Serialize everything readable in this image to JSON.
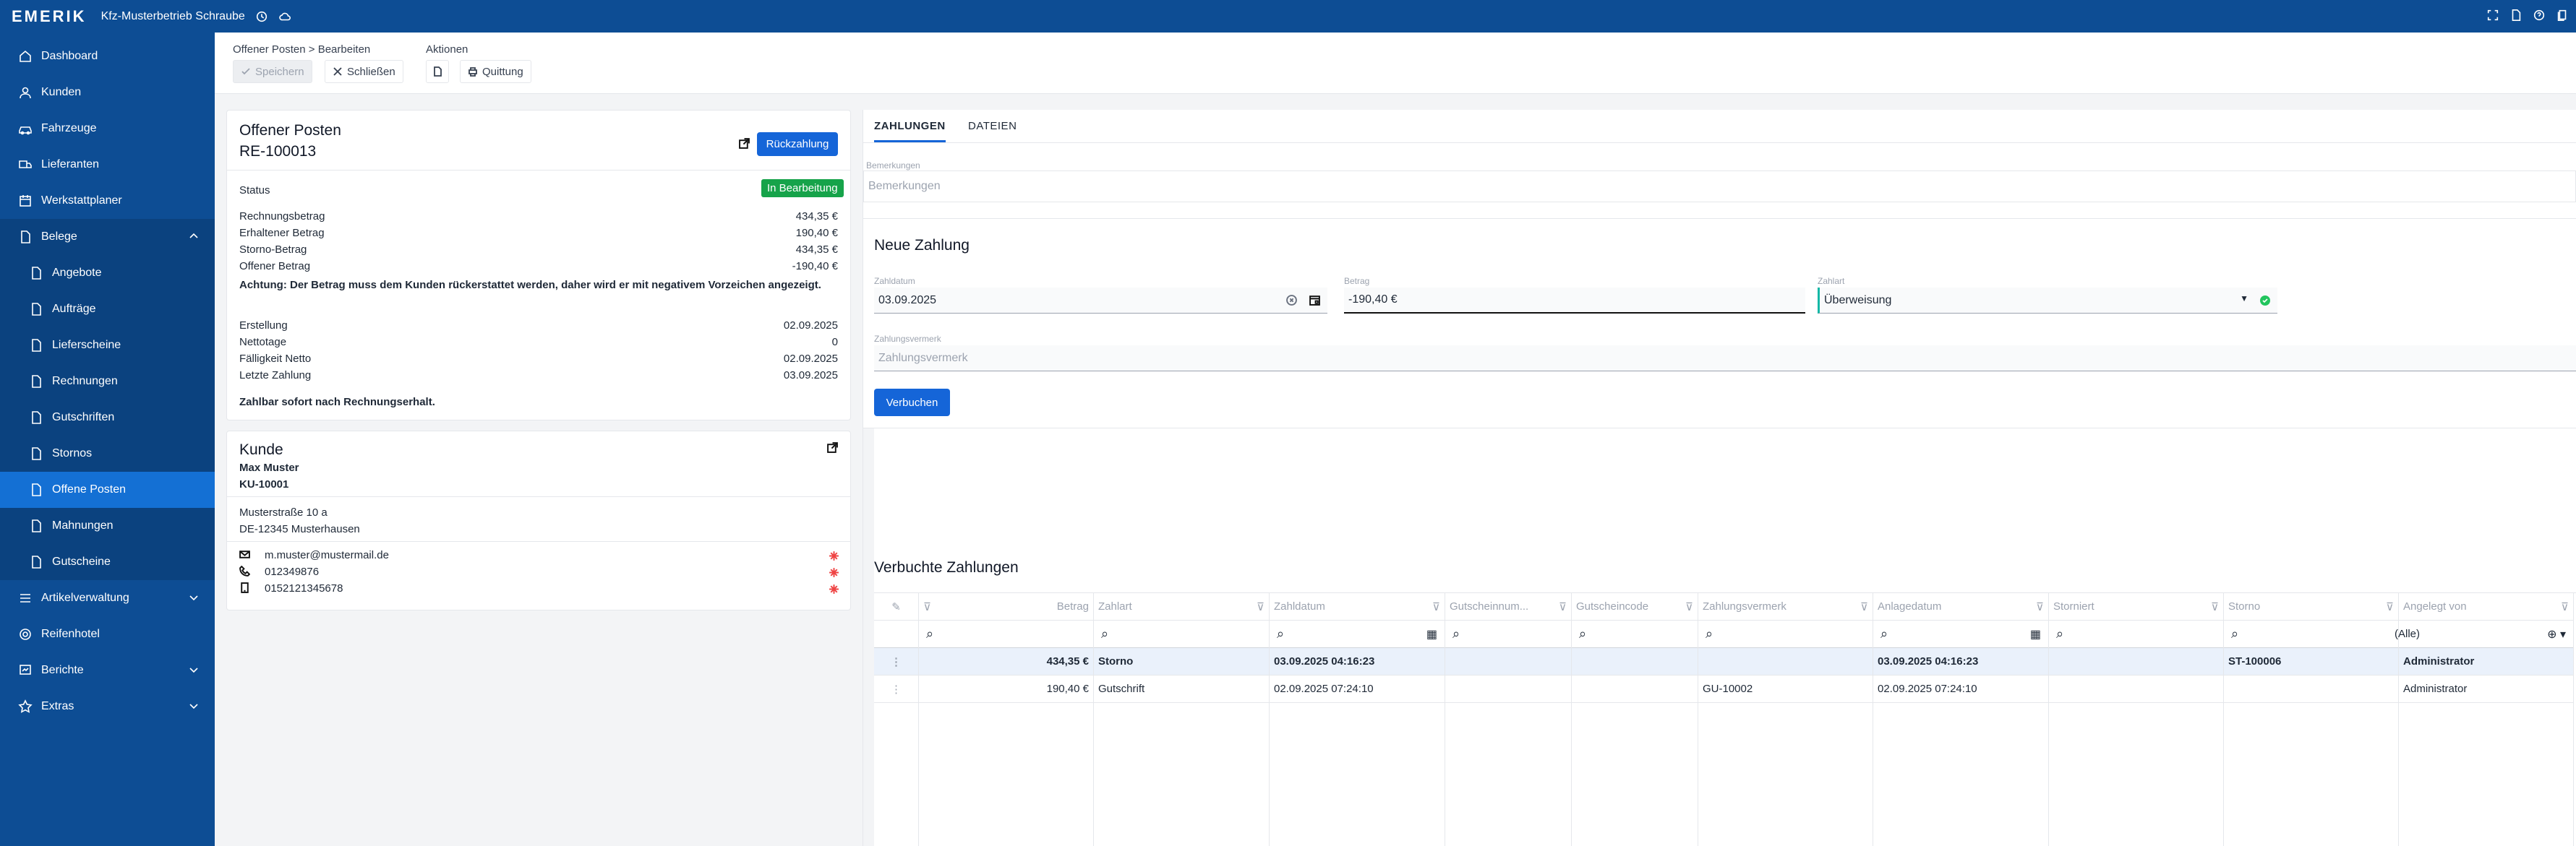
{
  "app": {
    "brand": "EMERIK",
    "tenant": "Kfz-Musterbetrieb Schraube"
  },
  "sidebar": {
    "items": [
      {
        "label": "Dashboard",
        "icon": "home-icon"
      },
      {
        "label": "Kunden",
        "icon": "user-icon"
      },
      {
        "label": "Fahrzeuge",
        "icon": "car-icon"
      },
      {
        "label": "Lieferanten",
        "icon": "truck-icon"
      },
      {
        "label": "Werkstattplaner",
        "icon": "calendar-icon"
      },
      {
        "label": "Belege",
        "icon": "document-icon"
      },
      {
        "label": "Angebote",
        "icon": "document-icon"
      },
      {
        "label": "Aufträge",
        "icon": "document-icon"
      },
      {
        "label": "Lieferscheine",
        "icon": "document-icon"
      },
      {
        "label": "Rechnungen",
        "icon": "document-icon"
      },
      {
        "label": "Gutschriften",
        "icon": "document-icon"
      },
      {
        "label": "Stornos",
        "icon": "document-icon"
      },
      {
        "label": "Offene Posten",
        "icon": "document-icon"
      },
      {
        "label": "Mahnungen",
        "icon": "document-icon"
      },
      {
        "label": "Gutscheine",
        "icon": "document-icon"
      },
      {
        "label": "Artikelverwaltung",
        "icon": "list-icon"
      },
      {
        "label": "Reifenhotel",
        "icon": "tire-icon"
      },
      {
        "label": "Berichte",
        "icon": "chart-icon"
      },
      {
        "label": "Extras",
        "icon": "star-icon"
      }
    ]
  },
  "breadcrumb": "Offener Posten > Bearbeiten",
  "actions_label": "Aktionen",
  "toolbar": {
    "save": "Speichern",
    "close": "Schließen",
    "receipt": "Quittung"
  },
  "op": {
    "title": "Offener Posten",
    "number": "RE-100013",
    "refund": "Rückzahlung",
    "status_label": "Status",
    "status": "In Bearbeitung",
    "rows": [
      [
        "Rechnungsbetrag",
        "434,35 €"
      ],
      [
        "Erhaltener Betrag",
        "190,40 €"
      ],
      [
        "Storno-Betrag",
        "434,35 €"
      ],
      [
        "Offener Betrag",
        "-190,40 €"
      ]
    ],
    "warning": "Achtung: Der Betrag muss dem Kunden rückerstattet werden, daher wird er mit negativem Vorzeichen angezeigt.",
    "dates": [
      [
        "Erstellung",
        "02.09.2025"
      ],
      [
        "Nettotage",
        "0"
      ],
      [
        "Fälligkeit Netto",
        "02.09.2025"
      ],
      [
        "Letzte Zahlung",
        "03.09.2025"
      ]
    ],
    "terms": "Zahlbar sofort nach Rechnungserhalt."
  },
  "customer": {
    "title": "Kunde",
    "name": "Max Muster",
    "number": "KU-10001",
    "street": "Musterstraße 10 a",
    "city": "DE-12345 Musterhausen",
    "email": "m.muster@mustermail.de",
    "phone": "012349876",
    "mobile": "0152121345678"
  },
  "tabs": [
    "ZAHLUNGEN",
    "DATEIEN"
  ],
  "remarks": {
    "label": "Bemerkungen",
    "placeholder": "Bemerkungen"
  },
  "payment": {
    "title": "Neue Zahlung",
    "date_label": "Zahldatum",
    "date": "03.09.2025",
    "amount_label": "Betrag",
    "amount": "-190,40 €",
    "type_label": "Zahlart",
    "type": "Überweisung",
    "note_label": "Zahlungsvermerk",
    "note_placeholder": "Zahlungsvermerk",
    "book": "Verbuchen"
  },
  "booked": {
    "title": "Verbuchte Zahlungen",
    "columns": [
      "Betrag",
      "Zahlart",
      "Zahldatum",
      "Gutscheinnum...",
      "Gutscheincode",
      "Zahlungsvermerk",
      "Anlagedatum",
      "Storniert",
      "Storno",
      "Angelegt von"
    ],
    "filter_all": "(Alle)",
    "rows": [
      [
        "434,35 €",
        "Storno",
        "03.09.2025 04:16:23",
        "",
        "",
        "",
        "03.09.2025 04:16:23",
        "",
        "ST-100006",
        "Administrator"
      ],
      [
        "190,40 €",
        "Gutschrift",
        "02.09.2025 07:24:10",
        "",
        "",
        "GU-10002",
        "02.09.2025 07:24:10",
        "",
        "",
        "Administrator"
      ]
    ]
  }
}
